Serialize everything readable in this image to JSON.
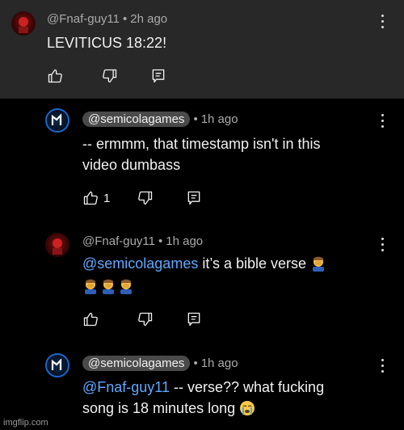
{
  "comments": [
    {
      "author": "@Fnaf-guy11",
      "time": "2h ago",
      "text": "LEVITICUS 18:22!"
    },
    {
      "author": "@semicolagames",
      "time": "1h ago",
      "line1": "-- ermmm, that timestamp isn't in this",
      "line2": "video dumbass",
      "like_count": "1"
    },
    {
      "author": "@Fnaf-guy11",
      "time": "1h ago",
      "mention": "@semicolagames",
      "line1_rest": " it’s a bible verse",
      "emoji": "man-facepalming-emoji"
    },
    {
      "author": "@semicolagames",
      "time": "1h ago",
      "mention": "@Fnaf-guy11",
      "line1_rest": " -- verse?? what fucking",
      "line2": "song is 18 minutes long",
      "emoji": "loudly-crying-face-emoji"
    }
  ],
  "dot": "•",
  "watermark": "imgflip.com"
}
